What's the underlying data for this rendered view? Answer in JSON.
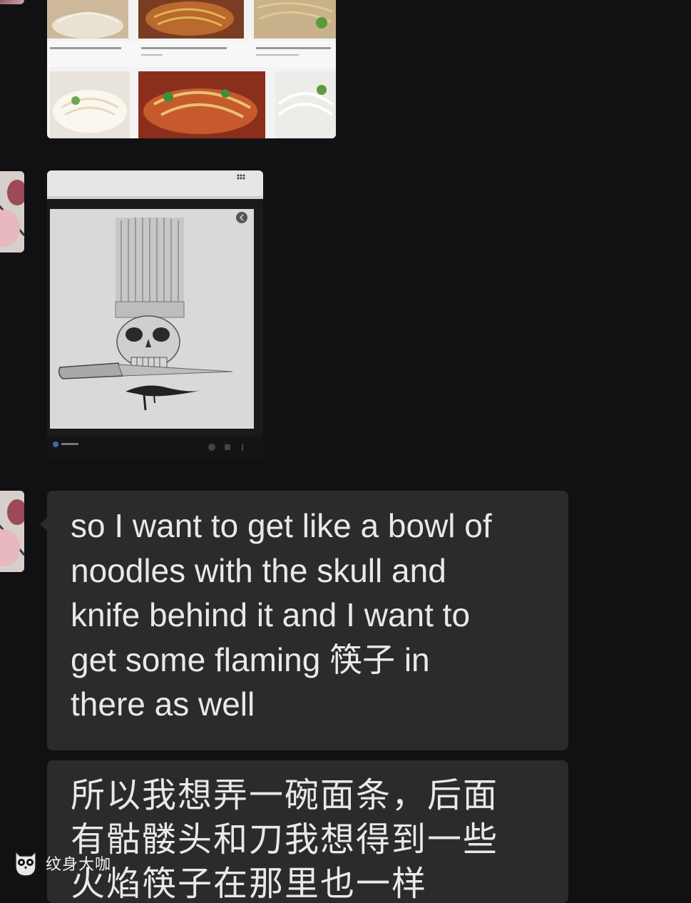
{
  "conversation": {
    "messages": [
      {
        "type": "image",
        "content": "noodle-search-results"
      },
      {
        "type": "image",
        "content": "skull-chef-drawing"
      },
      {
        "type": "text",
        "text": "so I want to get like a bowl of\nnoodles with the skull and\nknife behind it and I want to\nget some flaming 筷子 in\nthere as well"
      },
      {
        "type": "text",
        "text": "所以我想弄一碗面条，后面\n有骷髅头和刀我想得到一些\n火焰筷子在那里也一样"
      }
    ]
  },
  "watermark": {
    "text": "纹身大咖",
    "icon": "owl-icon"
  },
  "colors": {
    "background": "#111113",
    "bubble": "#2b2b2d",
    "text": "#e9e9e9"
  }
}
